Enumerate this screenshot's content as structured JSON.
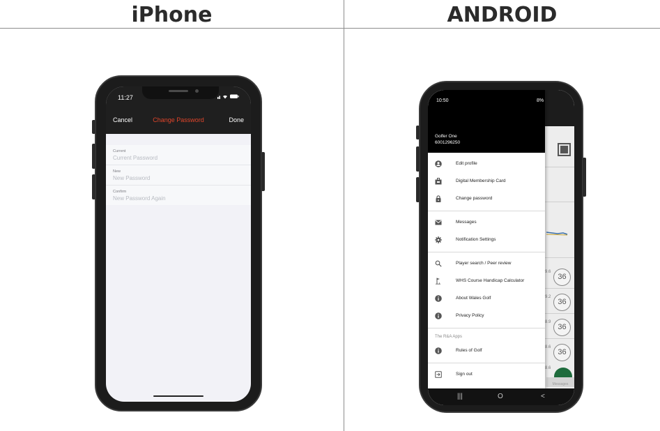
{
  "headings": {
    "left": "iPhone",
    "right": "ANDROID"
  },
  "iphone": {
    "status_time": "11:27",
    "nav": {
      "cancel": "Cancel",
      "title": "Change Password",
      "done": "Done"
    },
    "fields": [
      {
        "label": "Current",
        "placeholder": "Current Password"
      },
      {
        "label": "New",
        "placeholder": "New Password"
      },
      {
        "label": "Confirm",
        "placeholder": "New Password Again"
      }
    ]
  },
  "android": {
    "status_time": "10:50",
    "status_right": "8%",
    "user": {
      "name": "Golfer One",
      "number": "6001296250"
    },
    "menu_group1": [
      {
        "label": "Edit profile",
        "icon": "account-circle-icon"
      },
      {
        "label": "Digital Membership Card",
        "icon": "card-icon"
      },
      {
        "label": "Change password",
        "icon": "lock-icon"
      }
    ],
    "menu_group2": [
      {
        "label": "Messages",
        "icon": "envelope-icon"
      },
      {
        "label": "Notification Settings",
        "icon": "gear-icon"
      }
    ],
    "menu_group3": [
      {
        "label": "Player search / Peer review",
        "icon": "search-icon"
      },
      {
        "label": "WHS Course Handicap Calculator",
        "icon": "golf-flag-icon"
      },
      {
        "label": "About Wales Golf",
        "icon": "info-icon"
      },
      {
        "label": "Privacy Policy",
        "icon": "info-icon"
      }
    ],
    "section_label": "The R&A Apps",
    "menu_group4": [
      {
        "label": "Rules of Golf",
        "icon": "info-icon"
      }
    ],
    "sign_out": {
      "label": "Sign out",
      "icon": "sign-out-icon"
    },
    "background": {
      "badge_value": "36",
      "badge_numbers": [
        "9.6",
        "9.2",
        "8.9",
        "8.6",
        "8.6"
      ],
      "messages_tab": "Messages"
    },
    "nav_buttons": [
      "|||",
      "O",
      "<"
    ]
  }
}
